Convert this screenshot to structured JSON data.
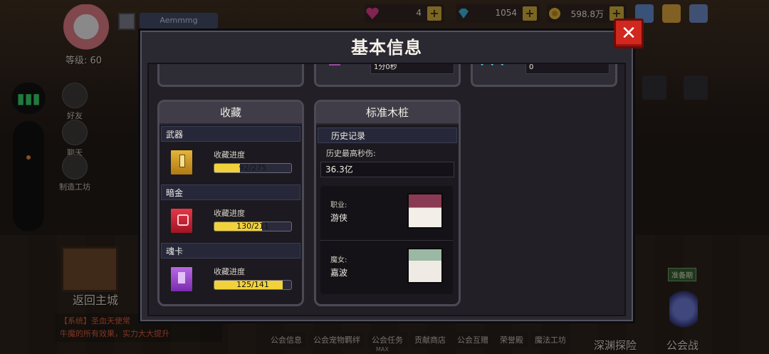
{
  "hud": {
    "player_name": "Aemmmg",
    "level_text": "等级: 60",
    "hearts": "4",
    "gems": "1054",
    "gold": "598.8万",
    "side": {
      "friends": "好友",
      "chat": "聊天",
      "workshop": "制造工坊"
    },
    "back_to_city": "返回主城",
    "system_msg_1": "【系统】圣血天使常",
    "system_msg_2": "牛魔的所有效果，实力大大提升",
    "bottom_tabs": [
      "公会信息",
      "公会宠物羁绊",
      "公会任务",
      "贡献商店",
      "公会互赠",
      "荣誉殿",
      "魔法工坊"
    ],
    "max_label": "MAX",
    "abyss": "深渊探险",
    "guild_war": "公会战",
    "ready_badge": "准备期",
    "colors": {
      "accent": "#d0271f",
      "progress": "#f2d23a",
      "panel": "#2a2932"
    }
  },
  "modal": {
    "title": "基本信息",
    "close_icon": "close-x-icon",
    "top_row": {
      "card2_value": "1分0秒",
      "card3_value": "0"
    },
    "collection": {
      "title": "收藏",
      "categories": [
        {
          "name": "武器",
          "label": "收藏进度",
          "progress": "92/275",
          "ratio": 0.3345
        },
        {
          "name": "暗金",
          "label": "收藏进度",
          "progress": "130/211",
          "ratio": 0.616
        },
        {
          "name": "魂卡",
          "label": "收藏进度",
          "progress": "125/141",
          "ratio": 0.8865
        }
      ]
    },
    "stake": {
      "title": "标准木桩",
      "history": "历史记录",
      "max_dps_label": "历史最高秒伤:",
      "max_dps_value": "36.3亿",
      "profession_key": "职业:",
      "profession_value": "游侠",
      "witch_key": "魔女:",
      "witch_value": "嘉波"
    }
  }
}
